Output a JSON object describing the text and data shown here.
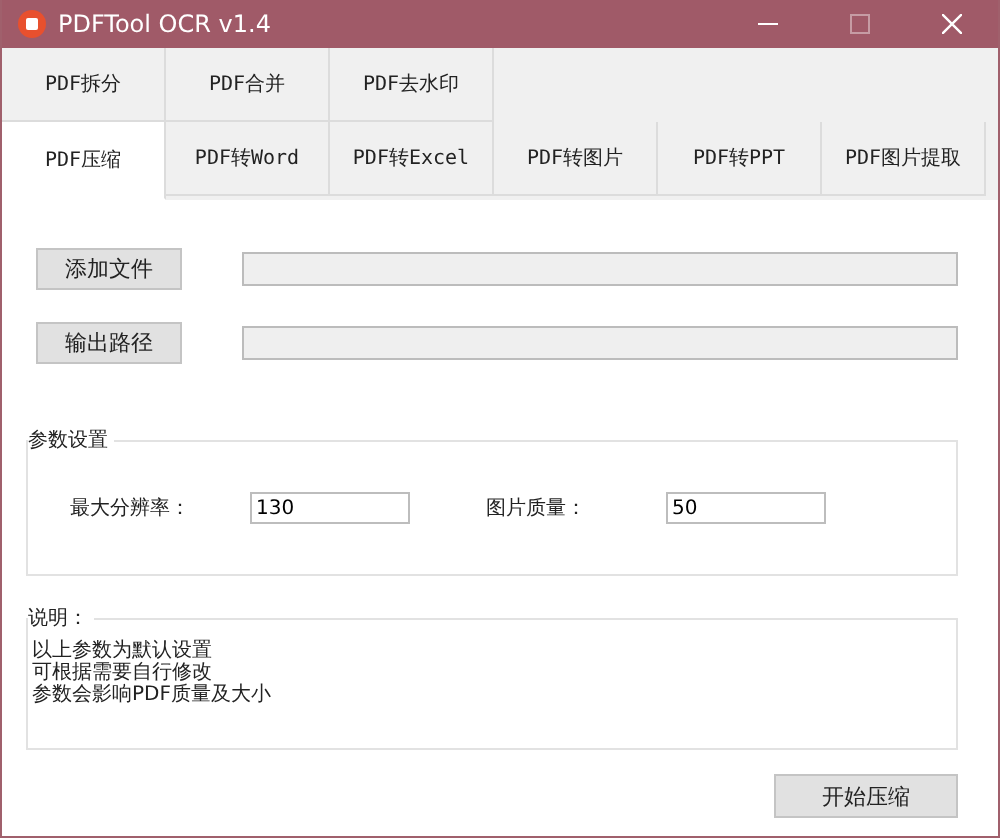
{
  "window": {
    "title": "PDFTool OCR v1.4"
  },
  "tab_rows": [
    [
      {
        "label": "PDF拆分",
        "selected": false
      },
      {
        "label": "PDF合并",
        "selected": false
      },
      {
        "label": "PDF去水印",
        "selected": false
      }
    ],
    [
      {
        "label": "PDF压缩",
        "selected": true
      },
      {
        "label": "PDF转Word",
        "selected": false
      },
      {
        "label": "PDF转Excel",
        "selected": false
      },
      {
        "label": "PDF转图片",
        "selected": false
      },
      {
        "label": "PDF转PPT",
        "selected": false
      },
      {
        "label": "PDF图片提取",
        "selected": false
      }
    ]
  ],
  "file_rows": [
    {
      "button": "添加文件"
    },
    {
      "button": "输出路径"
    }
  ],
  "params": {
    "title": "参数设置",
    "fields": [
      {
        "label": "最大分辨率：",
        "value": "130"
      },
      {
        "label": "图片质量：",
        "value": "50"
      }
    ]
  },
  "notes": {
    "title": "说明：",
    "lines": [
      "以上参数为默认设置",
      "可根据需要自行修改",
      "参数会影响PDF质量及大小"
    ]
  },
  "start_button": "开始压缩"
}
